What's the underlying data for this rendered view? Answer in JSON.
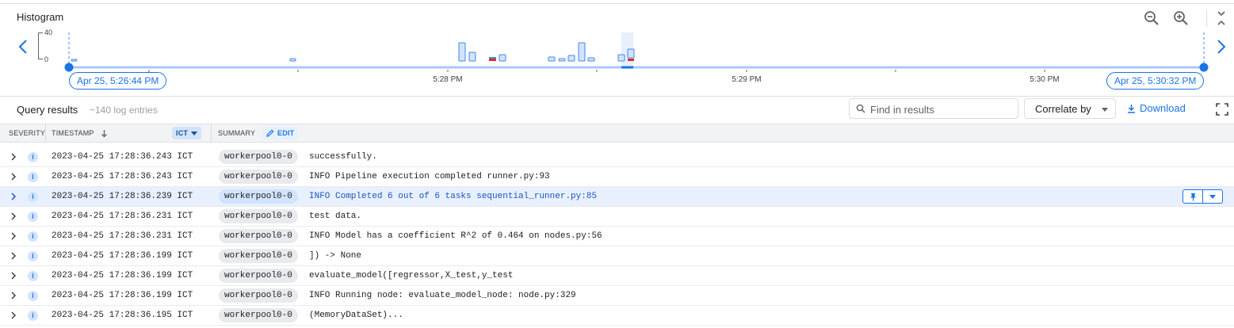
{
  "histogram": {
    "title": "Histogram",
    "y_max_label": "40",
    "y_min_label": "0",
    "range_start_label": "Apr 25, 5:26:44 PM",
    "range_end_label": "Apr 25, 5:30:32 PM",
    "tick_labels": [
      "5:28 PM",
      "5:29 PM",
      "5:30 PM"
    ],
    "colors": {
      "bar_fill": "#d2e3fc",
      "bar_stroke": "#4285f4",
      "axis_line": "#a8c7fa",
      "handle": "#1a73e8",
      "error": "#d93025"
    },
    "icons": {
      "prev": "chevron-left-icon",
      "next": "chevron-right-icon",
      "zoom_out": "zoom-out-icon",
      "zoom_in": "zoom-in-icon",
      "collapse": "unfold-less-icon"
    }
  },
  "toolbar": {
    "title": "Query results",
    "entry_count": "~140 log entries",
    "find_placeholder": "Find in results",
    "correlate_label": "Correlate by",
    "download_label": "Download"
  },
  "table": {
    "headers": {
      "severity": "SEVERITY",
      "timestamp": "TIMESTAMP",
      "timezone": "ICT",
      "summary": "SUMMARY",
      "edit": "EDIT"
    },
    "rows": [
      {
        "timestamp": "2023-04-25 17:28:36.243 ICT",
        "source": "workerpool0-0",
        "message": "successfully."
      },
      {
        "timestamp": "2023-04-25 17:28:36.243 ICT",
        "source": "workerpool0-0",
        "message": "INFO Pipeline execution completed runner.py:93"
      },
      {
        "timestamp": "2023-04-25 17:28:36.239 ICT",
        "source": "workerpool0-0",
        "message": "INFO Completed 6 out of 6 tasks sequential_runner.py:85"
      },
      {
        "timestamp": "2023-04-25 17:28:36.231 ICT",
        "source": "workerpool0-0",
        "message": "test data."
      },
      {
        "timestamp": "2023-04-25 17:28:36.231 ICT",
        "source": "workerpool0-0",
        "message": "INFO Model has a coefficient R^2 of 0.464 on nodes.py:56"
      },
      {
        "timestamp": "2023-04-25 17:28:36.199 ICT",
        "source": "workerpool0-0",
        "message": "]) -> None"
      },
      {
        "timestamp": "2023-04-25 17:28:36.199 ICT",
        "source": "workerpool0-0",
        "message": "evaluate_model([regressor,X_test,y_test"
      },
      {
        "timestamp": "2023-04-25 17:28:36.199 ICT",
        "source": "workerpool0-0",
        "message": "INFO Running node: evaluate_model_node: node.py:329"
      },
      {
        "timestamp": "2023-04-25 17:28:36.195 ICT",
        "source": "workerpool0-0",
        "message": "(MemoryDataSet)..."
      }
    ],
    "severity_symbol": "i"
  }
}
